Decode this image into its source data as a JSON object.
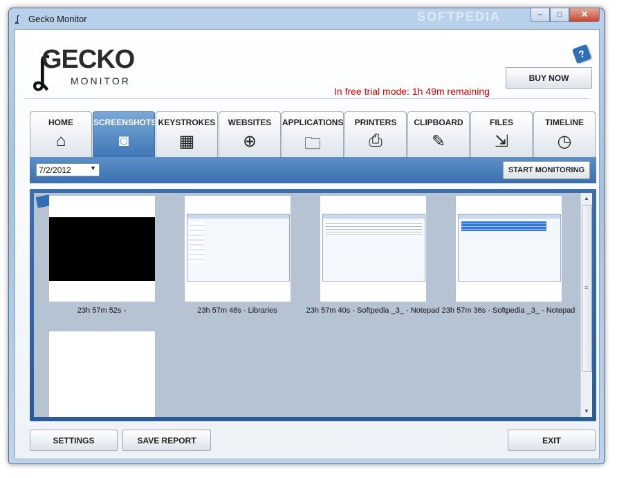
{
  "window": {
    "title": "Gecko Monitor",
    "watermark": "SOFTPEDIA",
    "caption_buttons": [
      "–",
      "□",
      "✕"
    ]
  },
  "logo": {
    "line1": "GECKO",
    "line2": "MONITOR"
  },
  "header": {
    "buy_now_label": "BUY NOW",
    "trial_text": "In free trial mode: 1h 49m remaining",
    "help_icon_glyph": "?"
  },
  "tabs": [
    {
      "label": "HOME",
      "icon": "⌂"
    },
    {
      "label": "SCREENSHOTS",
      "icon": "◙"
    },
    {
      "label": "KEYSTROKES",
      "icon": "▦"
    },
    {
      "label": "WEBSITES",
      "icon": "⊕"
    },
    {
      "label": "APPLICATIONS",
      "icon": "🗀"
    },
    {
      "label": "PRINTERS",
      "icon": "⎙"
    },
    {
      "label": "CLIPBOARD",
      "icon": "✎"
    },
    {
      "label": "FILES",
      "icon": "⇲"
    },
    {
      "label": "TIMELINE",
      "icon": "◷"
    }
  ],
  "active_tab": "SCREENSHOTS",
  "toolbar": {
    "date_value": "7/2/2012",
    "date_arrow": "▼",
    "start_monitoring_label": "START MONITORING"
  },
  "screenshots": [
    {
      "caption": "23h 57m 52s -"
    },
    {
      "caption": "23h 57m 48s - Libraries"
    },
    {
      "caption": "23h 57m 40s - Softpedia _3_ - Notepad"
    },
    {
      "caption": "23h 57m 36s - Softpedia _3_ - Notepad"
    },
    {
      "caption": ""
    }
  ],
  "scrollbar": {
    "up": "▲",
    "down": "▼",
    "grip": "≡"
  },
  "footer": {
    "settings_label": "SETTINGS",
    "save_report_label": "SAVE REPORT",
    "exit_label": "EXIT"
  }
}
